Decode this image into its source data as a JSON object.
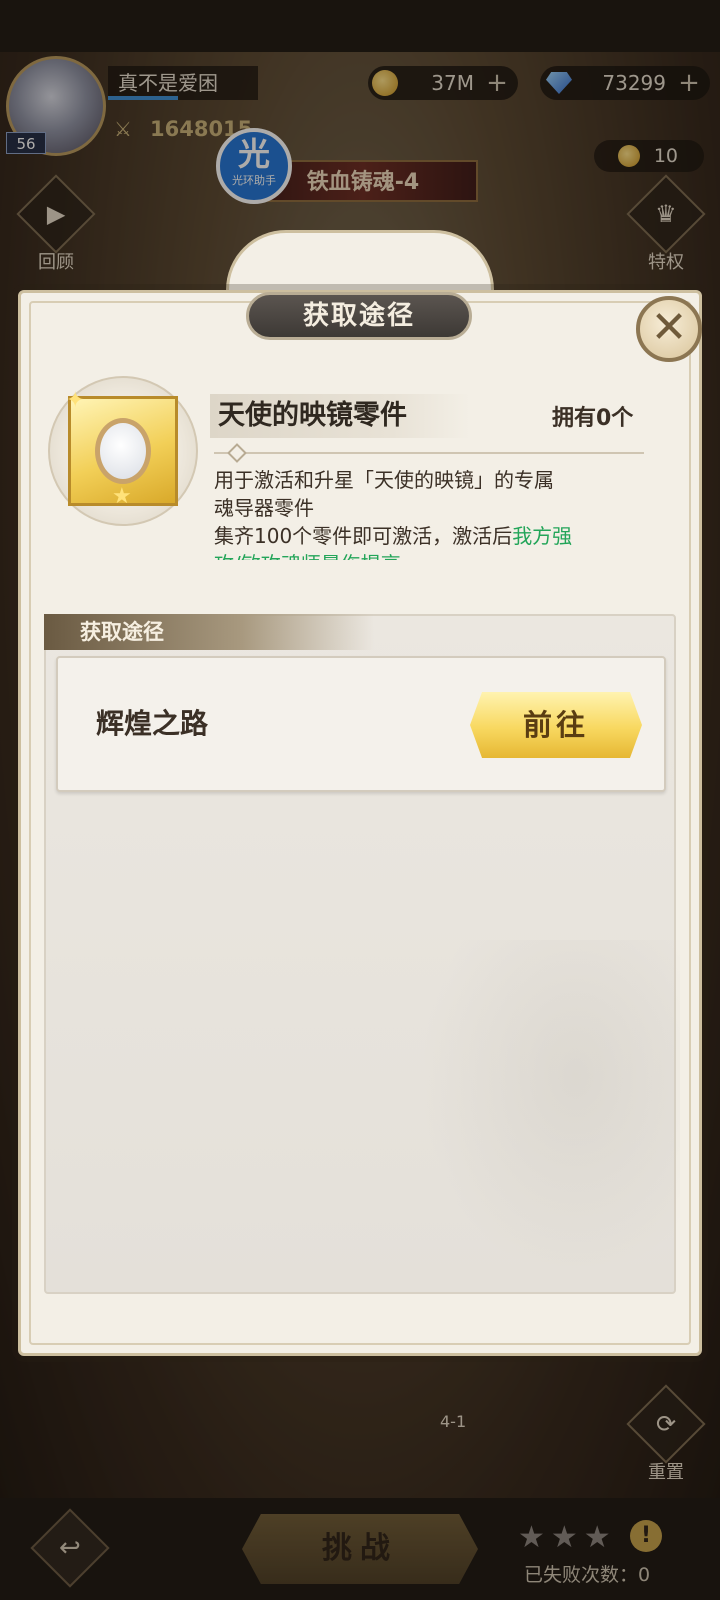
{
  "hud": {
    "avatar_level": "56",
    "player_name": "真不是爱困",
    "power": "1648015",
    "gold": "37M",
    "gems": "73299",
    "counter": "10",
    "stage_title": "铁血铸魂-4",
    "helper_badge_big": "光",
    "helper_badge_small": "光环助手",
    "review_label": "回顾",
    "privilege_label": "特权",
    "reset_label": "重置",
    "stage_node_label": "4-1"
  },
  "modal": {
    "title": "获取途径",
    "close_icon": "close-icon",
    "item": {
      "name": "天使的映镜零件",
      "owned": "拥有0个",
      "desc_line1": "用于激活和升星「天使的映镜」的专属",
      "desc_line2": "魂导器零件",
      "desc_line3a": "集齐100个零件即可激活，激活后",
      "desc_line3b": "我方强",
      "desc_line4": "攻/敏攻魂师暴伤提高"
    },
    "source_header": "获取途径",
    "sources": [
      {
        "name": "辉煌之路",
        "button": "前往"
      }
    ]
  },
  "bottom": {
    "challenge_label": "挑战",
    "stars": "★★★",
    "alert_icon": "!",
    "fail_count": "已失败次数：0"
  },
  "colors": {
    "accent_green": "#23a559",
    "go_button_gold": "#f8d860",
    "modal_bg": "#f3efe6"
  }
}
